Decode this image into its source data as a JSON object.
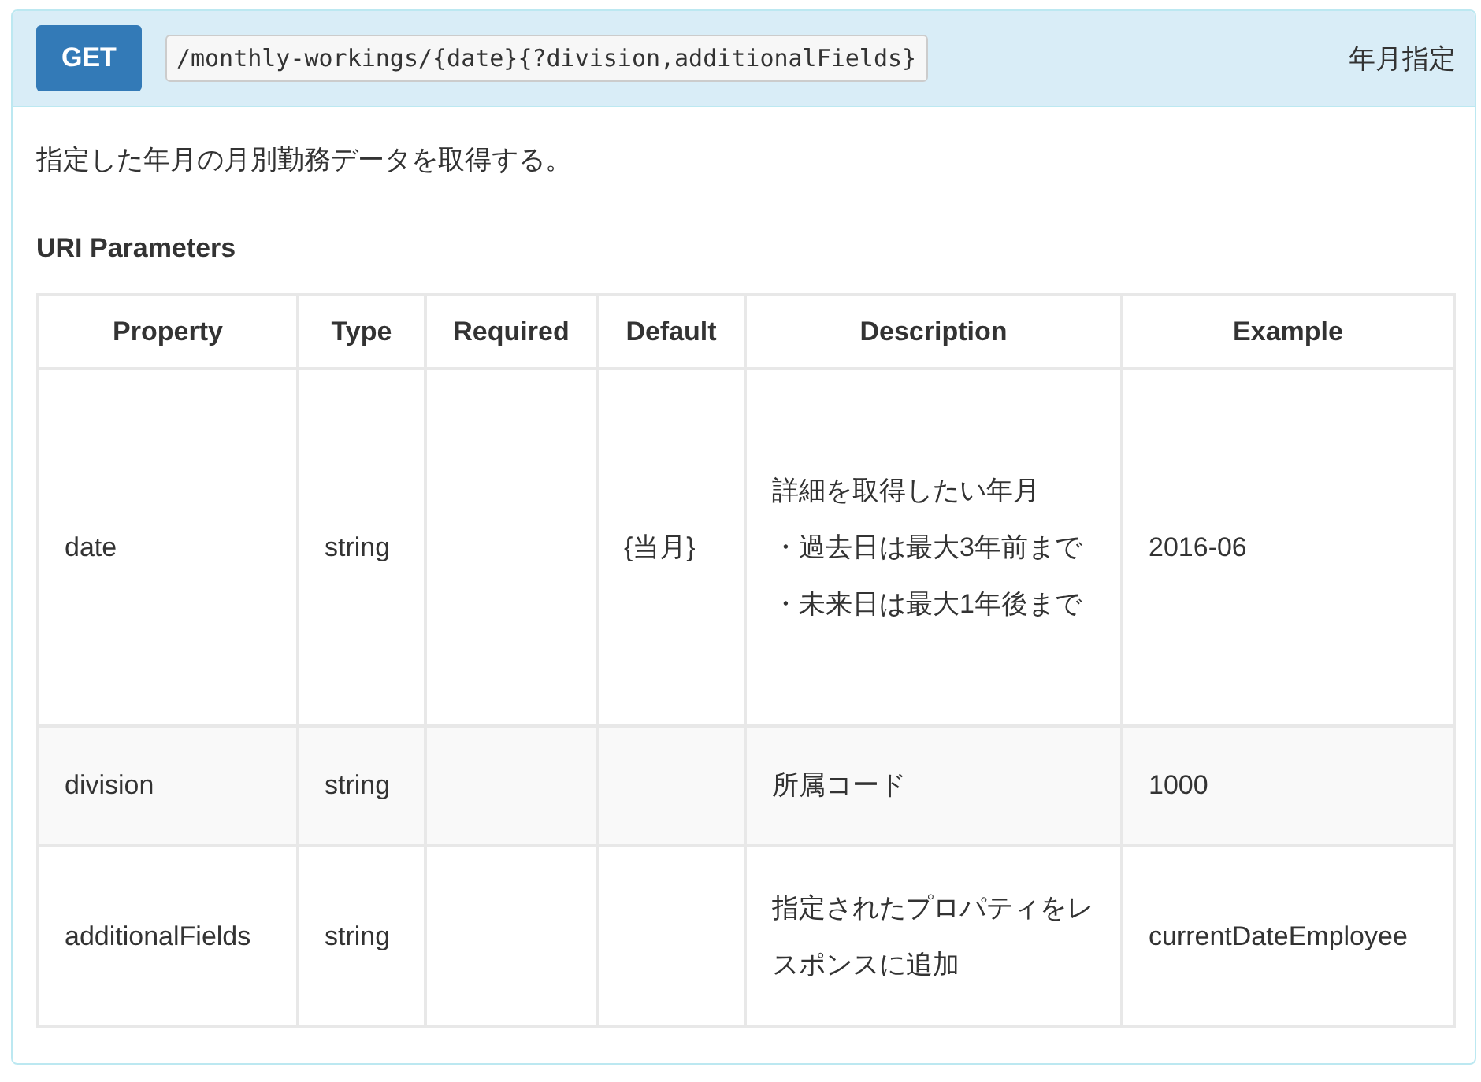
{
  "endpoint": {
    "method": "GET",
    "path": "/monthly-workings/{date}{?division,additionalFields}",
    "summary": "年月指定"
  },
  "description": "指定した年月の月別勤務データを取得する。",
  "section_title": "URI Parameters",
  "table": {
    "columns": [
      "Property",
      "Type",
      "Required",
      "Default",
      "Description",
      "Example"
    ],
    "rows": [
      {
        "property": "date",
        "type": "string",
        "required": "",
        "default": "{当月}",
        "description": [
          "詳細を取得したい年月",
          "・過去日は最大3年前まで",
          "・未来日は最大1年後まで"
        ],
        "example": "2016-06"
      },
      {
        "property": "division",
        "type": "string",
        "required": "",
        "default": "",
        "description": [
          "所属コード"
        ],
        "example": "1000"
      },
      {
        "property": "additionalFields",
        "type": "string",
        "required": "",
        "default": "",
        "description": [
          "指定されたプロパティをレスポンスに追加"
        ],
        "example": "currentDateEmployee"
      }
    ]
  }
}
